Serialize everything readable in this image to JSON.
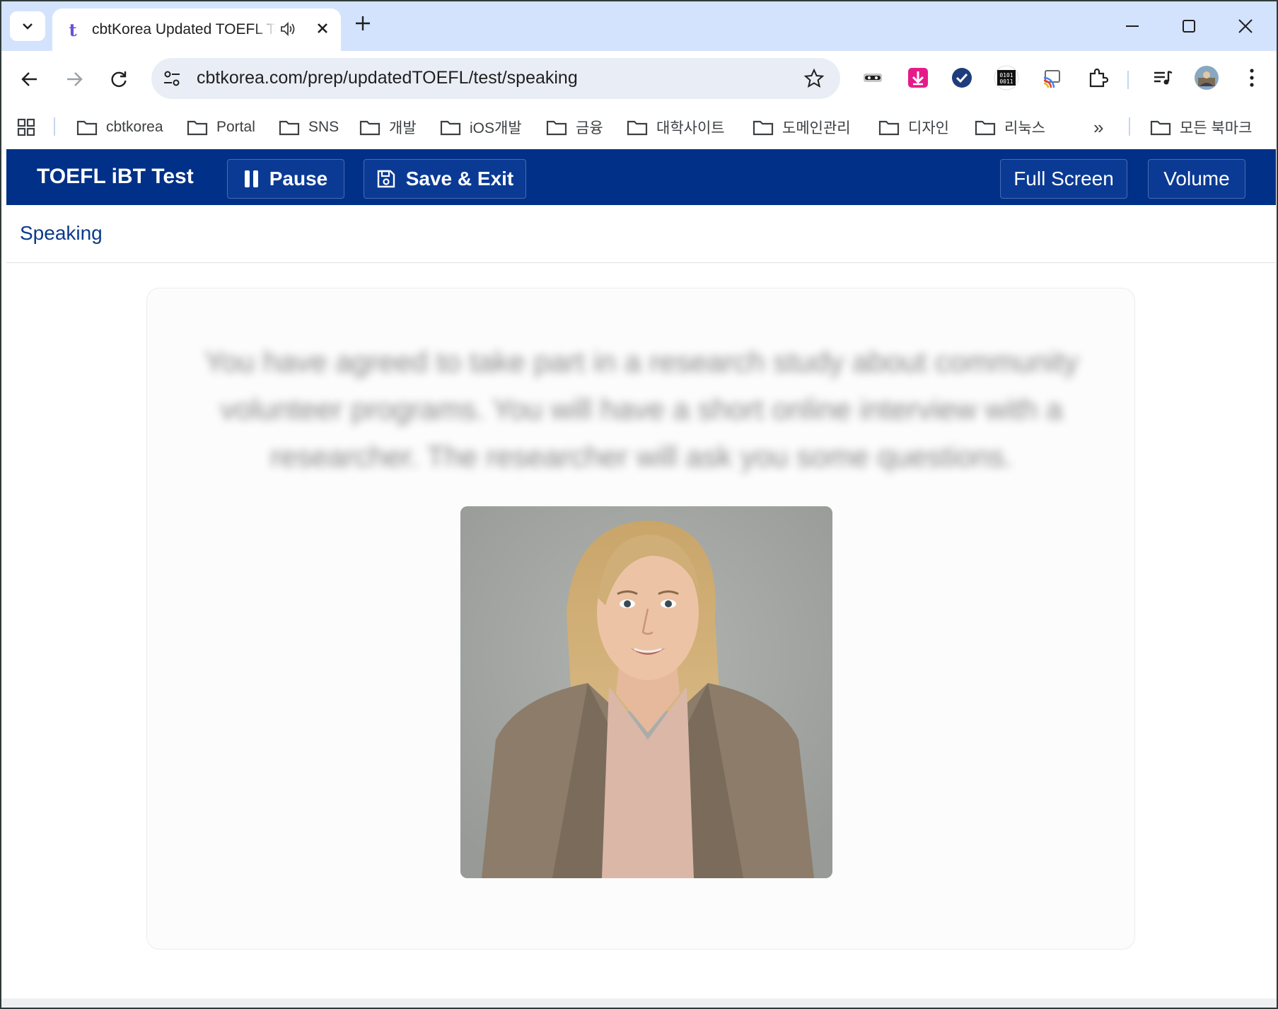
{
  "browser": {
    "tab": {
      "title": "cbtKorea Updated TOEFL Test",
      "favicon": "t"
    },
    "address_bar": {
      "url": "cbtkorea.com/prep/updatedTOEFL/test/speaking"
    },
    "extensions": [
      "incognito-mask-icon",
      "download-arrow-icon",
      "checkmark-icon",
      "binary-icon",
      "cast-icon",
      "puzzle-icon"
    ],
    "bookmarks": [
      {
        "label": "cbtkorea"
      },
      {
        "label": "Portal"
      },
      {
        "label": "SNS"
      },
      {
        "label": "개발"
      },
      {
        "label": "iOS개발"
      },
      {
        "label": "금융"
      },
      {
        "label": "대학사이트"
      },
      {
        "label": "도메인관리"
      },
      {
        "label": "디자인"
      },
      {
        "label": "리눅스"
      }
    ],
    "bookmarks_overflow": "»",
    "all_bookmarks": "모든 북마크"
  },
  "app": {
    "title": "TOEFL iBT Test",
    "pause_label": "Pause",
    "save_exit_label": "Save & Exit",
    "fullscreen_label": "Full Screen",
    "volume_label": "Volume",
    "brand_color": "#003087"
  },
  "section": {
    "label": "Speaking"
  },
  "prompt": {
    "text": "You have agreed to take part in a research study about community volunteer programs. You will have a short online interview with a researcher. The researcher will ask you some questions."
  }
}
